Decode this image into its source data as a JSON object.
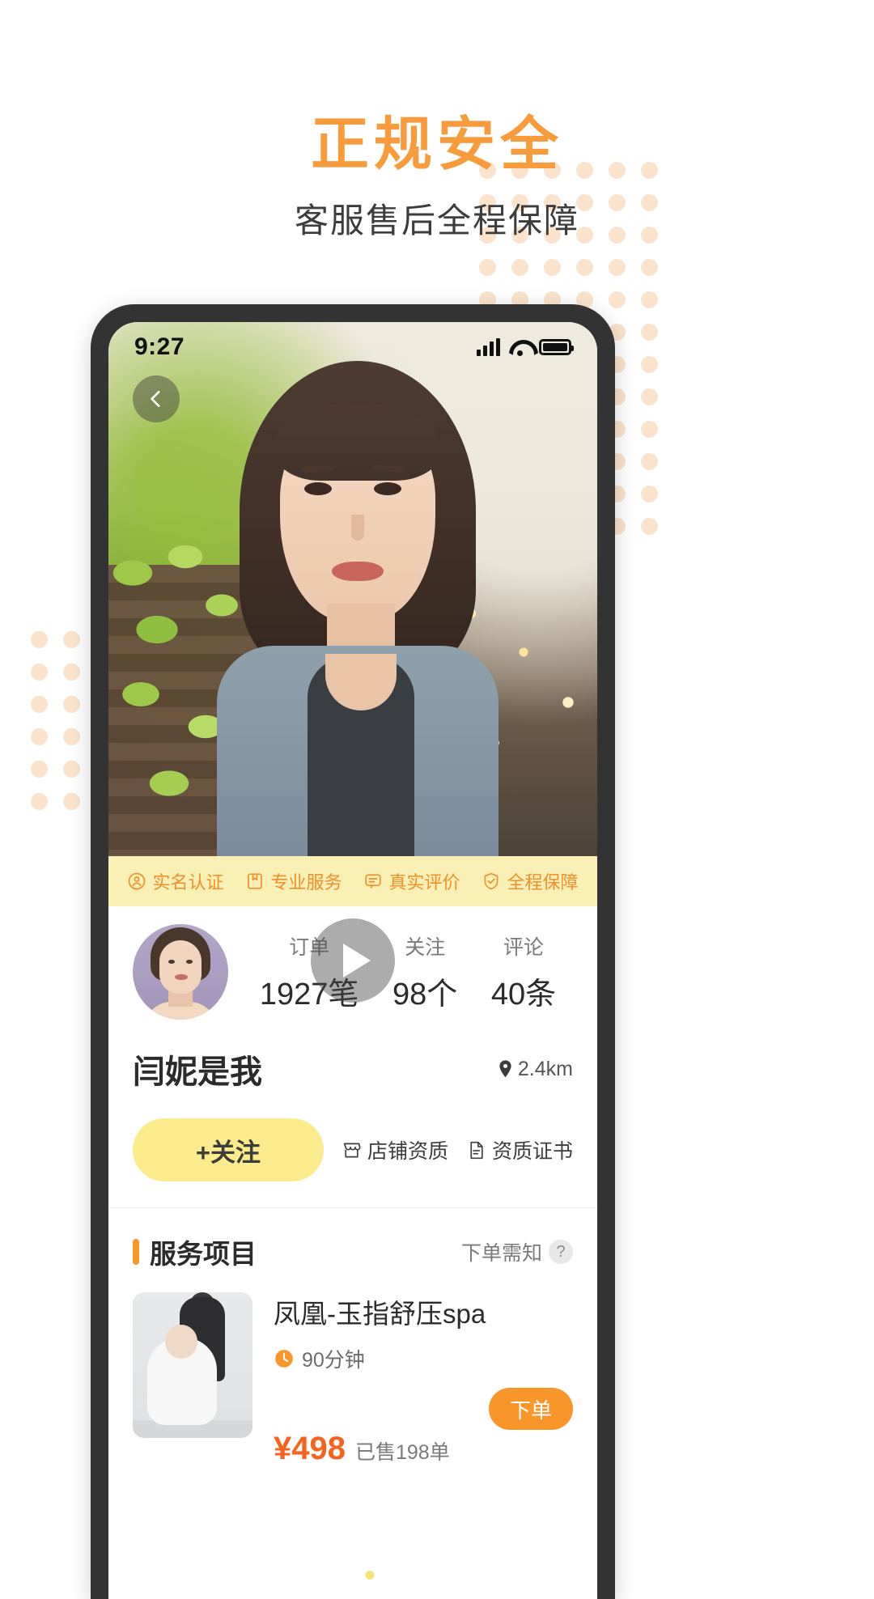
{
  "promo": {
    "headline": "正规安全",
    "subheadline": "客服售后全程保障",
    "headline_color": "#f89b3c",
    "dot_color": "#fce3cb"
  },
  "statusbar": {
    "time": "9:27",
    "signal_icon": "signal-bars-icon",
    "wifi_icon": "wifi-icon",
    "battery_icon": "battery-icon"
  },
  "hero": {
    "back_icon": "chevron-left-icon",
    "play_icon": "play-icon",
    "carousel": {
      "total": 3,
      "active_index": 2
    }
  },
  "badges": [
    {
      "label": "实名认证",
      "icon": "user-verified-icon"
    },
    {
      "label": "专业服务",
      "icon": "bookmark-icon"
    },
    {
      "label": "真实评价",
      "icon": "comment-icon"
    },
    {
      "label": "全程保障",
      "icon": "shield-check-icon"
    }
  ],
  "badge_strip_bg": "#faf0b6",
  "badge_text_color": "#f0902a",
  "profile": {
    "avatar_icon": "avatar",
    "shop_name": "闫妮是我",
    "distance": "2.4km",
    "distance_icon": "location-pin-icon",
    "stats": [
      {
        "label": "订单",
        "value": "1927笔"
      },
      {
        "label": "关注",
        "value": "98个"
      },
      {
        "label": "评论",
        "value": "40条"
      }
    ],
    "follow_label": "+关注",
    "follow_bg": "#fbeb8c",
    "links": [
      {
        "label": "店铺资质",
        "icon": "shop-icon"
      },
      {
        "label": "资质证书",
        "icon": "certificate-icon"
      }
    ]
  },
  "service_section": {
    "title": "服务项目",
    "accent_color": "#f8962a",
    "note": "下单需知",
    "note_icon": "question-mark-icon",
    "products": [
      {
        "title": "凤凰-玉指舒压spa",
        "duration": "90分钟",
        "duration_icon": "clock-icon",
        "price": "¥498",
        "sold": "已售198单",
        "order_label": "下单",
        "price_color": "#f8621f",
        "order_bg": "#f8962a"
      }
    ]
  }
}
